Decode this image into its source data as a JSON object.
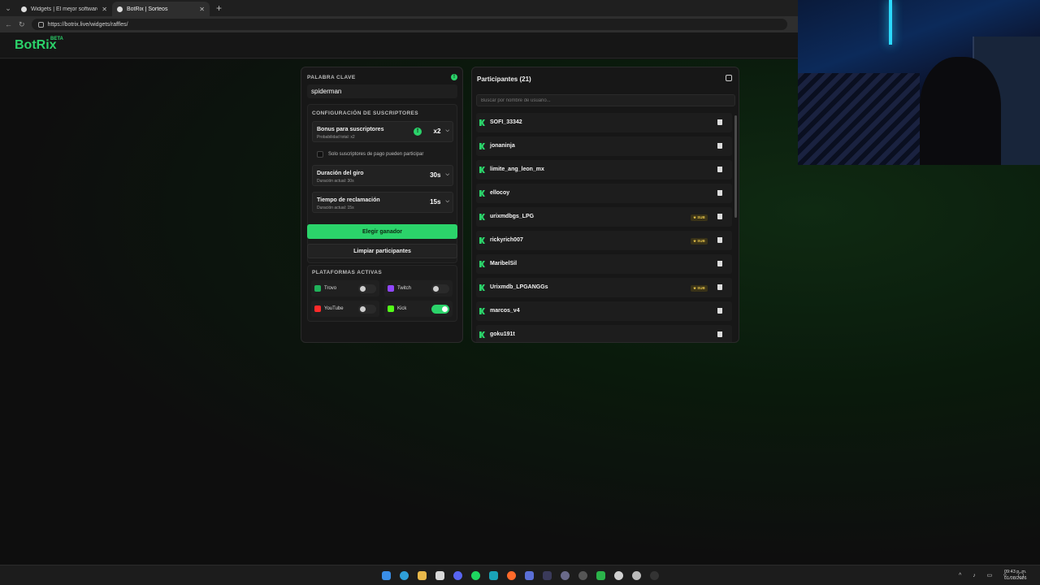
{
  "browser": {
    "tabs": [
      {
        "title": "Widgets | El mejor software para ...",
        "active": false
      },
      {
        "title": "BotRix | Sorteos",
        "active": true
      }
    ],
    "url": "https://botrix.live/widgets/raffles/"
  },
  "app": {
    "logo": "BotRix",
    "badge": "BETA"
  },
  "raffle": {
    "keyword_label": "PALABRA CLAVE",
    "keyword_value": "spiderman",
    "sub_config_title": "CONFIGURACIÓN DE SUSCRIPTORES",
    "bonus": {
      "title": "Bonus para suscriptores",
      "subtitle": "Probabilidad total: x2",
      "value": "x2"
    },
    "paid_only_label": "Solo suscriptores de pago pueden participar",
    "spin": {
      "title": "Duración del giro",
      "subtitle": "Duración actual: 30s",
      "value": "30s"
    },
    "claim": {
      "title": "Tiempo de reclamación",
      "subtitle": "Duración actual: 15s",
      "value": "15s"
    },
    "pick_button": "Elegir ganador",
    "clear_button": "Limpiar participantes",
    "platforms_title": "PLATAFORMAS ACTIVAS",
    "platforms": [
      {
        "name": "Trovo",
        "enabled": false,
        "color": "#20b15a"
      },
      {
        "name": "Twitch",
        "enabled": false,
        "color": "#9146ff"
      },
      {
        "name": "YouTube",
        "enabled": false,
        "color": "#ff2a2a"
      },
      {
        "name": "Kick",
        "enabled": true,
        "color": "#53fc18"
      }
    ]
  },
  "participants": {
    "title": "Participantes (21)",
    "search_placeholder": "Buscar por nombre de usuario...",
    "sub_badge": "SUB",
    "list": [
      {
        "name": "SOFI_33342",
        "sub": false
      },
      {
        "name": "jonaninja",
        "sub": false
      },
      {
        "name": "limite_ang_leon_mx",
        "sub": false
      },
      {
        "name": "ellocoy",
        "sub": false
      },
      {
        "name": "urixmdbgs_LPG",
        "sub": true
      },
      {
        "name": "rickyrich007",
        "sub": true
      },
      {
        "name": "MaribelSil",
        "sub": false
      },
      {
        "name": "Urixmdb_LPGANGGs",
        "sub": true
      },
      {
        "name": "marcos_v4",
        "sub": false
      },
      {
        "name": "goku191t",
        "sub": false
      }
    ]
  },
  "taskbar": {
    "time": "09:43 p. m.",
    "date": "01/08/2026"
  },
  "colors": {
    "accent": "#2bd36a",
    "sub_badge": "#e8c54a"
  }
}
